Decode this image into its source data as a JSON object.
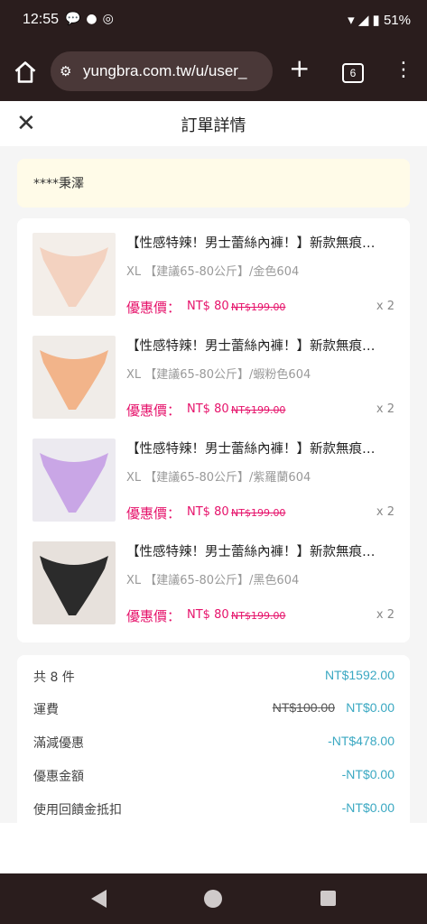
{
  "status_bar": {
    "time": "12:55",
    "battery": "51%"
  },
  "browser": {
    "url": "yungbra.com.tw/u/user_",
    "tab_count": "6"
  },
  "page": {
    "title": "訂單詳情",
    "recipient": "****秉澤"
  },
  "items": [
    {
      "title": "【性感特辣！男士蕾絲內褲！】新款無痕…",
      "variant": "XL 【建議65-80公斤】/金色604",
      "price_label": "優惠價：",
      "price": "NT$ 80",
      "original_price": "NT$199.00",
      "qty": "x 2",
      "swatch": "#f3d2c0"
    },
    {
      "title": "【性感特辣！男士蕾絲內褲！】新款無痕…",
      "variant": "XL 【建議65-80公斤】/蝦粉色604",
      "price_label": "優惠價：",
      "price": "NT$ 80",
      "original_price": "NT$199.00",
      "qty": "x 2",
      "swatch": "#f2b48a"
    },
    {
      "title": "【性感特辣！男士蕾絲內褲！】新款無痕…",
      "variant": "XL 【建議65-80公斤】/紫羅蘭604",
      "price_label": "優惠價：",
      "price": "NT$ 80",
      "original_price": "NT$199.00",
      "qty": "x 2",
      "swatch": "#c9a6e6"
    },
    {
      "title": "【性感特辣！男士蕾絲內褲！】新款無痕…",
      "variant": "XL 【建議65-80公斤】/黑色604",
      "price_label": "優惠價：",
      "price": "NT$ 80",
      "original_price": "NT$199.00",
      "qty": "x 2",
      "swatch": "#2b2b2b"
    }
  ],
  "summary": {
    "count_label": "共 8 件",
    "count_value": "NT$1592.00",
    "shipping_label": "運費",
    "shipping_original": "NT$100.00",
    "shipping_value": "NT$0.00",
    "discount_label": "滿減優惠",
    "discount_value": "-NT$478.00",
    "coupon_label": "優惠金額",
    "coupon_value": "-NT$0.00",
    "credit_label": "使用回饋金抵扣",
    "credit_value": "-NT$0.00"
  },
  "colors": {
    "accent_pink": "#e6136b",
    "accent_teal": "#3aa8c2",
    "bar": "#2a1d1d"
  }
}
